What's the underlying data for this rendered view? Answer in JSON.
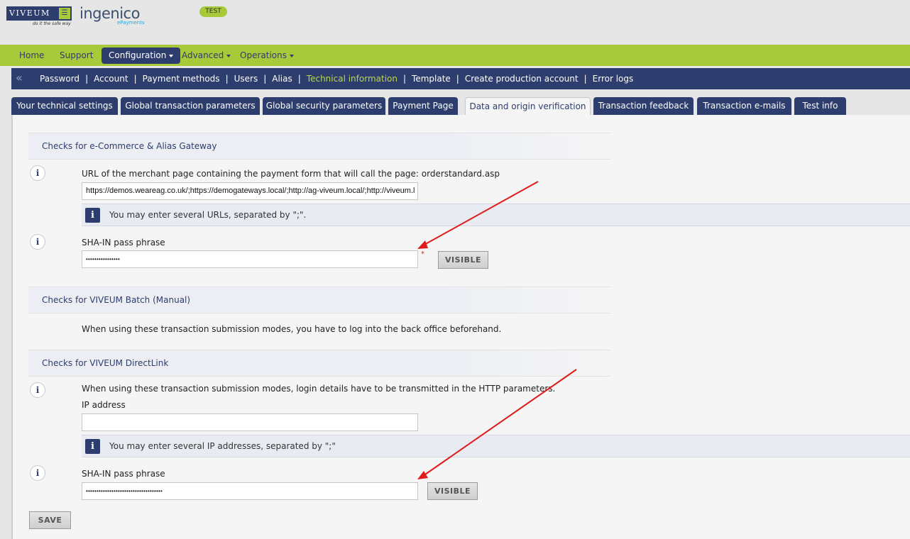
{
  "header": {
    "brand_viveum": "VIVEUM",
    "brand_tagline": "do it the safe way",
    "brand_ingenico": "ingenico",
    "brand_epayments": "ePayments",
    "env_badge": "TEST"
  },
  "mainnav": {
    "items": [
      "Home",
      "Support",
      "Configuration",
      "Advanced",
      "Operations"
    ],
    "active": "Configuration"
  },
  "subnav": {
    "links": [
      "Password",
      "Account",
      "Payment methods",
      "Users",
      "Alias",
      "Technical information",
      "Template",
      "Create production account",
      "Error logs"
    ],
    "active": "Technical information",
    "separator": "|"
  },
  "tabs": {
    "items": [
      "Your technical settings",
      "Global transaction parameters",
      "Global security parameters",
      "Payment Page",
      "Data and origin verification",
      "Transaction feedback",
      "Transaction e-mails",
      "Test info"
    ],
    "active": "Data and origin verification"
  },
  "sections": {
    "ecommerce": {
      "title": "Checks for e-Commerce & Alias Gateway",
      "url_label": "URL of the merchant page containing the payment form that will call the page: orderstandard.asp",
      "url_value": "https://demos.weareag.co.uk/;https://demogateways.local/;http://ag-viveum.local/;http://viveum.l",
      "url_note": "You may enter several URLs, separated by \";\".",
      "sha_label": "SHA-IN pass phrase",
      "sha_value": "••••••••••••••••",
      "required_mark": "*",
      "visible_button": "VISIBLE"
    },
    "batch": {
      "title": "Checks for VIVEUM Batch (Manual)",
      "text": "When using these transaction submission modes, you have to log into the back office beforehand."
    },
    "directlink": {
      "title": "Checks for VIVEUM DirectLink",
      "intro": "When using these transaction submission modes, login details have to be transmitted in the HTTP parameters.",
      "ip_label": "IP address",
      "ip_value": "",
      "ip_note": "You may enter several IP addresses, separated by \";\"",
      "sha_label": "SHA-IN pass phrase",
      "sha_value": "••••••••••••••••••••••••••••••••••••",
      "visible_button": "VISIBLE"
    }
  },
  "save_button": "SAVE",
  "icons": {
    "info": "i",
    "back": "«"
  },
  "colors": {
    "navy": "#2d3d6e",
    "lime": "#a8c93a",
    "active_link": "#b9d84a",
    "annotation_arrow": "#e01b1b"
  }
}
